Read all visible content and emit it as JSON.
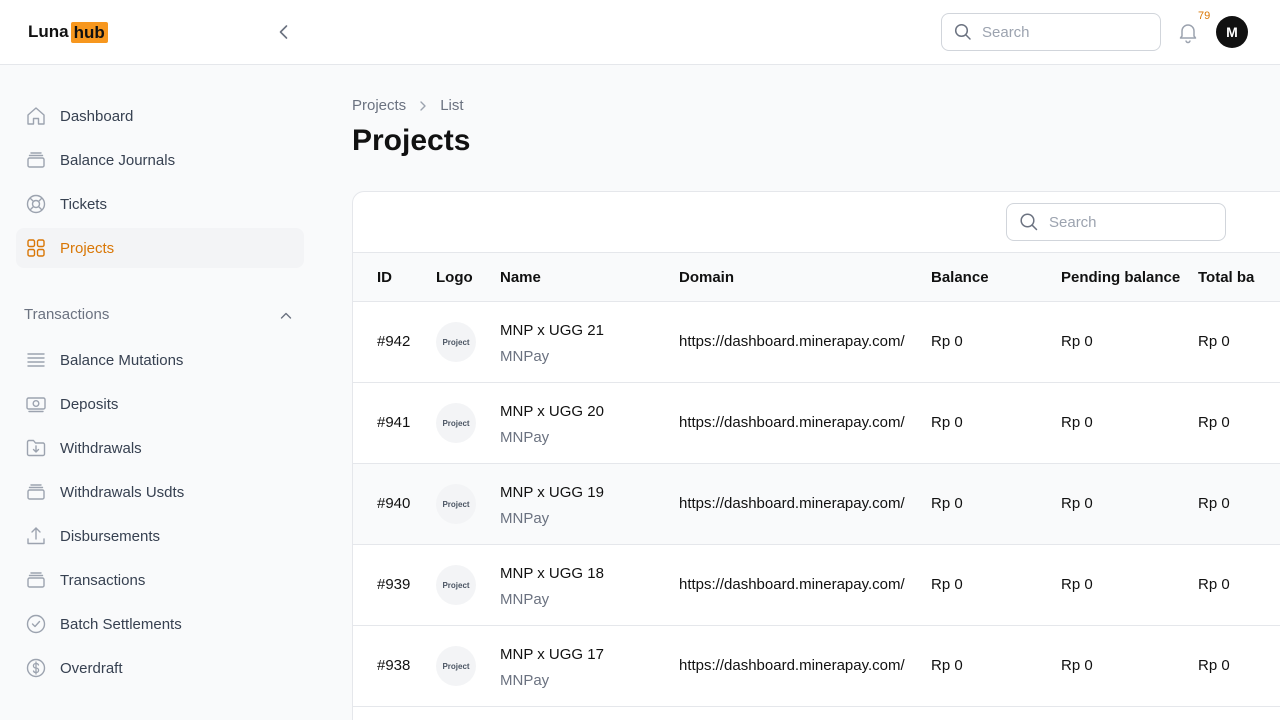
{
  "brand": {
    "part1": "Luna",
    "part2": "hub"
  },
  "topbar": {
    "search_placeholder": "Search",
    "notification_count": "79",
    "avatar_initial": "M"
  },
  "sidebar": {
    "items": [
      {
        "label": "Dashboard",
        "icon": "home-icon"
      },
      {
        "label": "Balance Journals",
        "icon": "stack-icon"
      },
      {
        "label": "Tickets",
        "icon": "lifebuoy-icon"
      },
      {
        "label": "Projects",
        "icon": "grid-icon",
        "active": true
      }
    ],
    "group": {
      "label": "Transactions",
      "expanded": true
    },
    "group_items": [
      {
        "label": "Balance Mutations",
        "icon": "list-icon"
      },
      {
        "label": "Deposits",
        "icon": "banknote-icon"
      },
      {
        "label": "Withdrawals",
        "icon": "folder-download-icon"
      },
      {
        "label": "Withdrawals Usdts",
        "icon": "stack-icon"
      },
      {
        "label": "Disbursements",
        "icon": "upload-icon"
      },
      {
        "label": "Transactions",
        "icon": "stack-icon"
      },
      {
        "label": "Batch Settlements",
        "icon": "check-circle-icon"
      },
      {
        "label": "Overdraft",
        "icon": "dollar-circle-icon"
      }
    ]
  },
  "breadcrumb": {
    "parent": "Projects",
    "current": "List"
  },
  "page": {
    "title": "Projects"
  },
  "table": {
    "search_placeholder": "Search",
    "columns": [
      "ID",
      "Logo",
      "Name",
      "Domain",
      "Balance",
      "Pending balance",
      "Total ba"
    ],
    "rows": [
      {
        "id": "#942",
        "logo": "Project",
        "name": "MNP x UGG 21",
        "sub": "MNPay",
        "domain": "https://dashboard.minerapay.com/",
        "balance": "Rp 0",
        "pending": "Rp 0",
        "total": "Rp 0"
      },
      {
        "id": "#941",
        "logo": "Project",
        "name": "MNP x UGG 20",
        "sub": "MNPay",
        "domain": "https://dashboard.minerapay.com/",
        "balance": "Rp 0",
        "pending": "Rp 0",
        "total": "Rp 0"
      },
      {
        "id": "#940",
        "logo": "Project",
        "name": "MNP x UGG 19",
        "sub": "MNPay",
        "domain": "https://dashboard.minerapay.com/",
        "balance": "Rp 0",
        "pending": "Rp 0",
        "total": "Rp 0"
      },
      {
        "id": "#939",
        "logo": "Project",
        "name": "MNP x UGG 18",
        "sub": "MNPay",
        "domain": "https://dashboard.minerapay.com/",
        "balance": "Rp 0",
        "pending": "Rp 0",
        "total": "Rp 0"
      },
      {
        "id": "#938",
        "logo": "Project",
        "name": "MNP x UGG 17",
        "sub": "MNPay",
        "domain": "https://dashboard.minerapay.com/",
        "balance": "Rp 0",
        "pending": "Rp 0",
        "total": "Rp 0"
      }
    ]
  },
  "colors": {
    "accent": "#d97706",
    "brand": "#f7971e"
  }
}
